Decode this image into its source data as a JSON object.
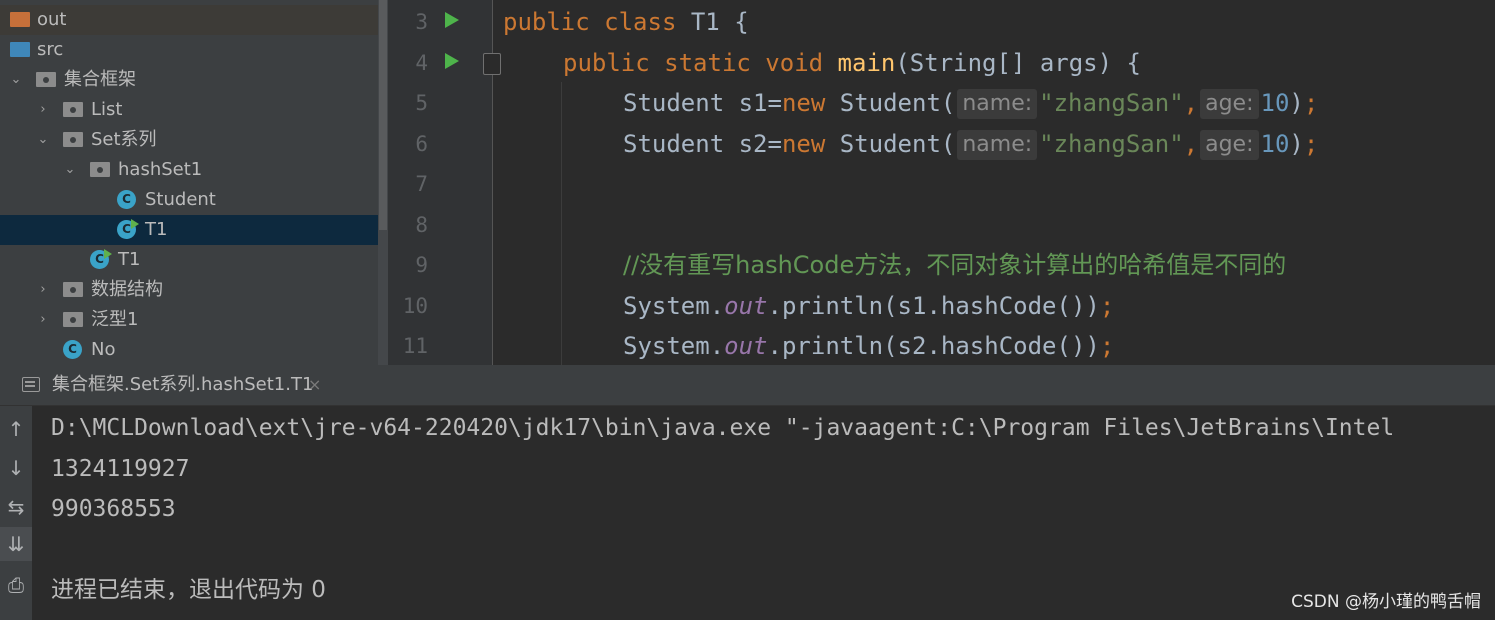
{
  "project_tree": {
    "items": [
      {
        "label": "out",
        "icon": "folder-orange-icon",
        "depth": 0,
        "arrow": ""
      },
      {
        "label": "src",
        "icon": "folder-blue-icon",
        "depth": 0,
        "arrow": ""
      },
      {
        "label": "集合框架",
        "icon": "package-icon",
        "depth": 0,
        "arrow": "expanded"
      },
      {
        "label": "List",
        "icon": "package-icon",
        "depth": 1,
        "arrow": "collapsed"
      },
      {
        "label": "Set系列",
        "icon": "package-icon",
        "depth": 1,
        "arrow": "expanded"
      },
      {
        "label": "hashSet1",
        "icon": "package-icon",
        "depth": 2,
        "arrow": "expanded"
      },
      {
        "label": "Student",
        "icon": "class-icon",
        "depth": 3,
        "arrow": ""
      },
      {
        "label": "T1",
        "icon": "class-runnable-icon",
        "depth": 3,
        "arrow": "",
        "selected": true
      },
      {
        "label": "T1",
        "icon": "class-runnable-icon",
        "depth": 2,
        "arrow": ""
      },
      {
        "label": "数据结构",
        "icon": "package-icon",
        "depth": 1,
        "arrow": "collapsed"
      },
      {
        "label": "泛型1",
        "icon": "package-icon",
        "depth": 1,
        "arrow": "collapsed"
      },
      {
        "label": "No",
        "icon": "class-icon",
        "depth": 1,
        "arrow": ""
      }
    ]
  },
  "editor": {
    "line_numbers": [
      "3",
      "4",
      "5",
      "6",
      "7",
      "8",
      "9",
      "10",
      "11"
    ],
    "line3": {
      "kw": "public class ",
      "rest": "T1 {"
    },
    "line4": {
      "kw": "public static void ",
      "fn": "main",
      "rest": "(String[] args) {"
    },
    "line5": {
      "a": "Student s1=",
      "kw": "new ",
      "b": "Student(",
      "hint1": "name:",
      "str": "\"zhangSan\"",
      "comma": ",",
      "hint2": "age:",
      "num": "10",
      "close": ")",
      "semi": ";"
    },
    "line6": {
      "a": "Student s2=",
      "kw": "new ",
      "b": "Student(",
      "hint1": "name:",
      "str": "\"zhangSan\"",
      "comma": ",",
      "hint2": "age:",
      "num": "10",
      "close": ")",
      "semi": ";"
    },
    "line9": {
      "comment": "//没有重写hashCode方法，不同对象计算出的哈希值是不同的"
    },
    "line10": {
      "a": "System.",
      "field": "out",
      "b": ".println(s1.hashCode())",
      "semi": ";"
    },
    "line11": {
      "a": "System.",
      "field": "out",
      "b": ".println(s2.hashCode())",
      "semi": ";"
    }
  },
  "run_panel": {
    "tab_label": "集合框架.Set系列.hashSet1.T1",
    "tab_close": "×",
    "tools": [
      "↑",
      "↓",
      "⇆",
      "⇊",
      "⎙"
    ],
    "console": {
      "command": "D:\\MCLDownload\\ext\\jre-v64-220420\\jdk17\\bin\\java.exe \"-javaagent:C:\\Program Files\\JetBrains\\Intel",
      "out1": "1324119927",
      "out2": "990368553",
      "exit": "进程已结束，退出代码为 0"
    }
  },
  "watermark": "CSDN @杨小瑾的鸭舌帽",
  "colors": {
    "keyword": "#cc7832",
    "string": "#6a8759",
    "number": "#6897bb",
    "comment": "#629755",
    "method": "#ffc66d",
    "selection": "#0d293e"
  }
}
